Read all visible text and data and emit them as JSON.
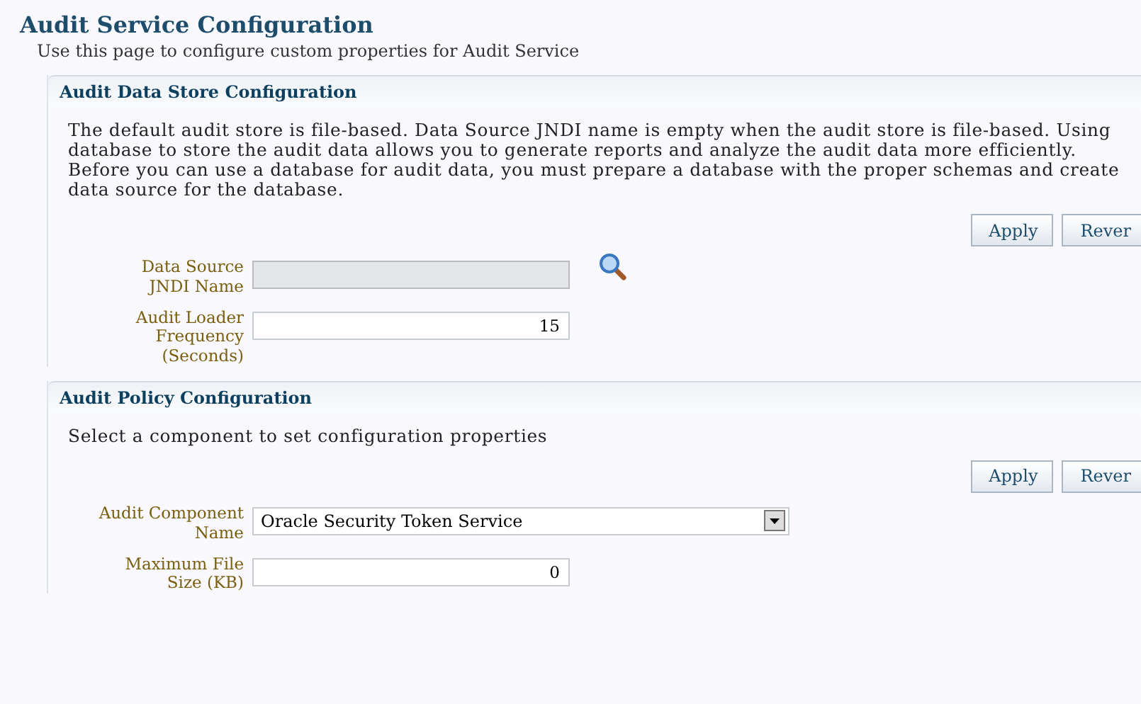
{
  "page": {
    "title": "Audit Service Configuration",
    "description": "Use this page to configure custom properties for Audit Service"
  },
  "sections": [
    {
      "title": "Audit Data Store Configuration",
      "text": "The default audit store is file-based. Data Source JNDI name is empty when the audit store is file-based. Using\ndatabase to store the audit data allows you to generate reports and analyze the audit data more efficiently.\nBefore you can use a database for audit data, you must prepare a database with the proper schemas and create\ndata source for the database.",
      "buttons": [
        "Apply",
        "Rever"
      ],
      "fields": [
        {
          "label": "Data Source JNDI Name",
          "kind": "text",
          "disabled": true,
          "search": true
        },
        {
          "label": "Audit Loader Frequency (Seconds)",
          "kind": "text",
          "value": "15",
          "disabled": false,
          "search": false
        }
      ]
    },
    {
      "title": "Audit Policy Configuration",
      "text": "Select a component to set configuration properties",
      "buttons": [
        "Apply",
        "Rever"
      ],
      "fields": [
        {
          "label": "Audit Component Name",
          "kind": "select",
          "value": "Oracle Security Token Service",
          "disabled": false,
          "search": false
        },
        {
          "label": "Maximum File Size (KB)",
          "kind": "text",
          "value": "0",
          "disabled": false,
          "search": false
        }
      ]
    }
  ]
}
